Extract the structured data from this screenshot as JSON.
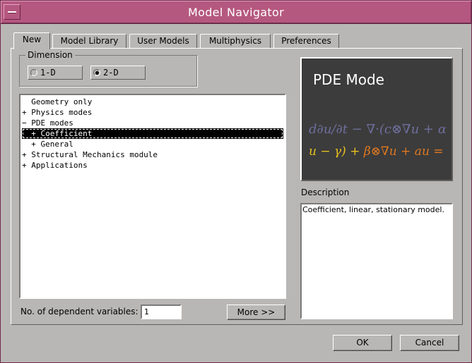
{
  "window": {
    "title": "Model Navigator"
  },
  "tabs": [
    {
      "label": "New",
      "active": true
    },
    {
      "label": "Model Library"
    },
    {
      "label": "User Models"
    },
    {
      "label": "Multiphysics"
    },
    {
      "label": "Preferences"
    }
  ],
  "dimension": {
    "legend": "Dimension",
    "options": [
      {
        "label": "1-D",
        "selected": false
      },
      {
        "label": "2-D",
        "selected": true
      }
    ]
  },
  "tree": {
    "items": [
      {
        "text": "  Geometry only"
      },
      {
        "text": "+ Physics modes"
      },
      {
        "text": "− PDE modes"
      },
      {
        "text": "  + Coefficient",
        "selected": true
      },
      {
        "text": "  + General"
      },
      {
        "text": "+ Structural Mechanics module"
      },
      {
        "text": "+ Applications"
      }
    ]
  },
  "dep_vars": {
    "label": "No. of dependent variables:",
    "value": "1"
  },
  "buttons": {
    "more": "More >>",
    "ok": "OK",
    "cancel": "Cancel"
  },
  "preview": {
    "title": "PDE Mode",
    "eq_line1": "d∂u/∂t − ∇·(c⊗∇u + α",
    "eq_line2_a": "u − γ) + ",
    "eq_line2_b": "β⊗∇u + au = ",
    "colors": {
      "bg": "#3c3c3c",
      "eq1": "#6e6e9e",
      "eq2a": "#e8c020",
      "eq2b": "#e07820"
    }
  },
  "description": {
    "label": "Description",
    "text": "Coefficient, linear, stationary model."
  },
  "theme": {
    "titlebar": "#b5587f",
    "window_bg": "#b9b7b5"
  }
}
